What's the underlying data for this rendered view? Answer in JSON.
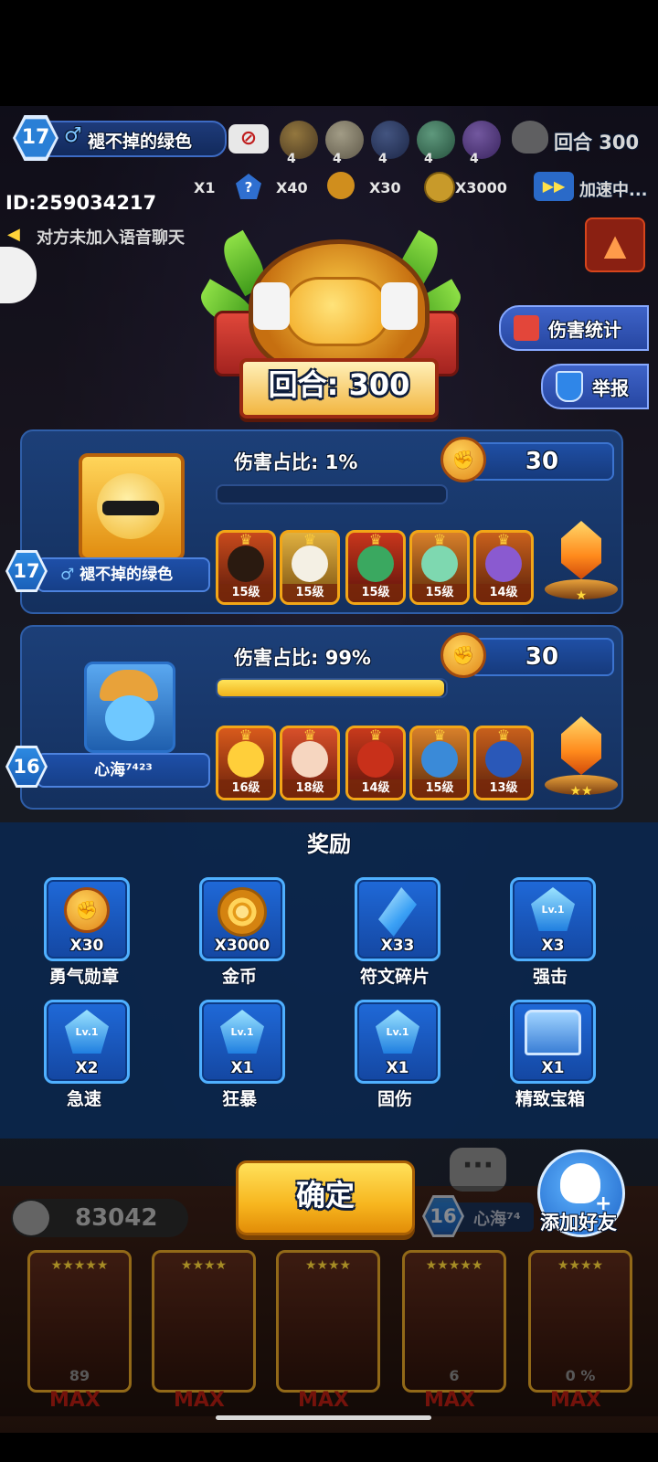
{
  "hud": {
    "player_level": "17",
    "player_name": "褪不掉的绿色",
    "gender_symbol": "♂",
    "enemy_counts": [
      "4",
      "4",
      "4",
      "4",
      "4"
    ],
    "round_label": "回合 300",
    "player_id": "ID:259034217",
    "voice_status": "对方未加入语音聊天",
    "rewards_row": {
      "mult": "X1",
      "q": "X40",
      "b": "X30",
      "coins": "X3000"
    },
    "speed_label": "加速中..."
  },
  "trophy": {
    "round_text": "回合: 300"
  },
  "side": {
    "damage_stats": "伤害统计",
    "report": "举报"
  },
  "players": [
    {
      "level": "17",
      "gender": "♂",
      "name": "褪不掉的绿色",
      "damage_label": "伤害占比: 1%",
      "damage_fraction": 0.01,
      "medals": "30",
      "crystal_stars": "★",
      "heroes": [
        "15级",
        "15级",
        "15级",
        "15级",
        "14级"
      ]
    },
    {
      "level": "16",
      "name": "心海⁷⁴²³",
      "damage_label": "伤害占比: 99%",
      "damage_fraction": 0.99,
      "medals": "30",
      "crystal_stars": "★★",
      "heroes": [
        "16级",
        "18级",
        "14级",
        "15级",
        "13级"
      ]
    }
  ],
  "rewards": {
    "title": "奖励",
    "items": [
      {
        "qty": "X30",
        "name": "勇气勋章",
        "icon": "medal-icon"
      },
      {
        "qty": "X3000",
        "name": "金币",
        "icon": "coin-icon"
      },
      {
        "qty": "X33",
        "name": "符文碎片",
        "icon": "rune-shard-icon"
      },
      {
        "qty": "X3",
        "name": "强击",
        "icon": "strike-rune-icon",
        "badge": "Lv.1"
      },
      {
        "qty": "X2",
        "name": "急速",
        "icon": "haste-rune-icon",
        "badge": "Lv.1"
      },
      {
        "qty": "X1",
        "name": "狂暴",
        "icon": "rage-rune-icon",
        "badge": "Lv.1"
      },
      {
        "qty": "X1",
        "name": "固伤",
        "icon": "fixed-damage-rune-icon",
        "badge": "Lv.1"
      },
      {
        "qty": "X1",
        "name": "精致宝箱",
        "icon": "chest-icon"
      }
    ]
  },
  "confirm_label": "确定",
  "add_friend_label": "添加好友",
  "bottom": {
    "gold": "83042",
    "opponent_level": "16",
    "opponent_name": "心海⁷⁴",
    "card_values": [
      "89",
      "",
      "",
      "6",
      "0 %"
    ],
    "max_label": "MAX"
  },
  "colors": {
    "accent_gold": "#f7b51e",
    "panel_blue": "#1c3f78",
    "tile_blue": "#1f69d8"
  }
}
